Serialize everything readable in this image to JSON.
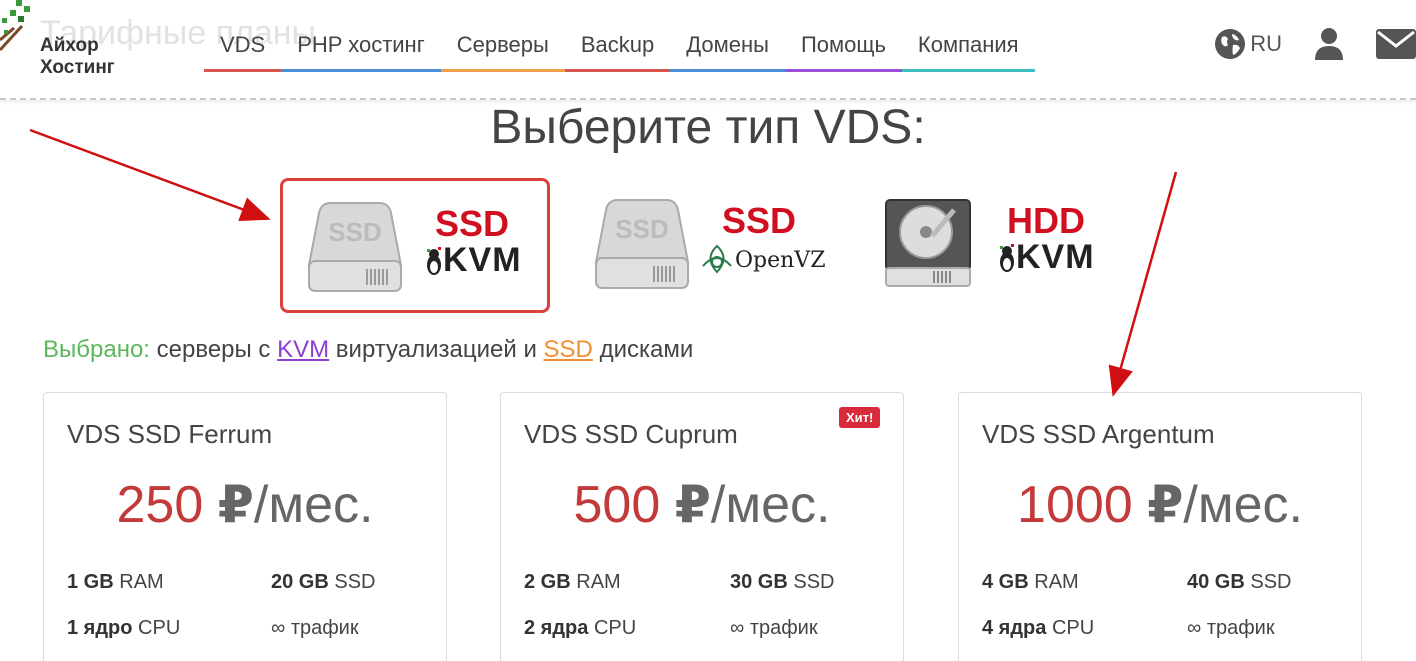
{
  "header": {
    "logo_line1": "Айхор",
    "logo_line2": "Хостинг",
    "ghost_title": "Тарифные планы",
    "nav": [
      {
        "label": "VDS",
        "color": "#d9534f"
      },
      {
        "label": "PHP хостинг",
        "color": "#4a90d9"
      },
      {
        "label": "Серверы",
        "color": "#f0a04b"
      },
      {
        "label": "Backup",
        "color": "#d9534f"
      },
      {
        "label": "Домены",
        "color": "#4a90d9"
      },
      {
        "label": "Помощь",
        "color": "#9b4fd9"
      },
      {
        "label": "Компания",
        "color": "#3bbfbf"
      }
    ],
    "lang": "RU",
    "icons": [
      "globe-icon",
      "user-icon",
      "mail-icon"
    ]
  },
  "main": {
    "heading": "Выберите тип VDS:",
    "vds_types": [
      {
        "top": "SSD",
        "sub": "KVM",
        "active": true
      },
      {
        "top": "SSD",
        "sub": "OpenVZ",
        "active": false
      },
      {
        "top": "HDD",
        "sub": "KVM",
        "active": false
      }
    ],
    "selected": {
      "prefix": "Выбрано:",
      "text1": "серверы с",
      "kvm": "KVM",
      "text2": "виртуализацией и",
      "ssd": "SSD",
      "text3": "дисками"
    },
    "plans": [
      {
        "name": "VDS SSD Ferrum",
        "price": "250",
        "currency": "₽",
        "period": "/мес.",
        "ram_val": "1 GB",
        "ram": "RAM",
        "ssd_val": "20 GB",
        "ssd": "SSD",
        "cpu_val": "1 ядро",
        "cpu": "CPU",
        "traffic": "∞ трафик",
        "badge": ""
      },
      {
        "name": "VDS SSD Cuprum",
        "price": "500",
        "currency": "₽",
        "period": "/мес.",
        "ram_val": "2 GB",
        "ram": "RAM",
        "ssd_val": "30 GB",
        "ssd": "SSD",
        "cpu_val": "2 ядра",
        "cpu": "CPU",
        "traffic": "∞ трафик",
        "badge": "Хит!"
      },
      {
        "name": "VDS SSD Argentum",
        "price": "1000",
        "currency": "₽",
        "period": "/мес.",
        "ram_val": "4 GB",
        "ram": "RAM",
        "ssd_val": "40 GB",
        "ssd": "SSD",
        "cpu_val": "4 ядра",
        "cpu": "CPU",
        "traffic": "∞ трафик",
        "badge": ""
      }
    ]
  },
  "colors": {
    "accent_red": "#d9413a",
    "price_red": "#c23a3a",
    "ok_green": "#5cb85c"
  }
}
